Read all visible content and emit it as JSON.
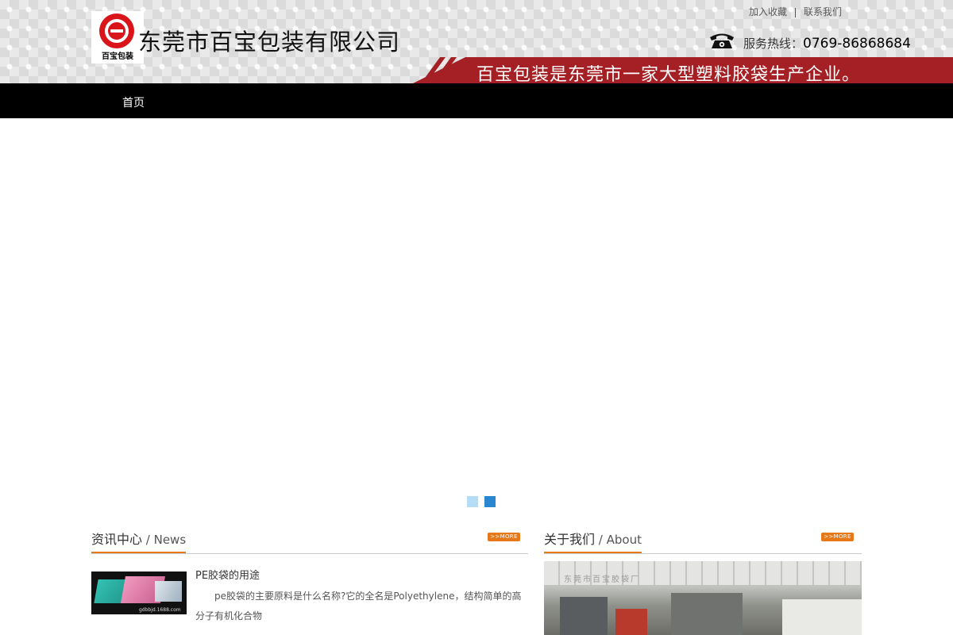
{
  "header": {
    "logo_text": "百宝包装",
    "company_name": "东莞市百宝包装有限公司",
    "top_links": [
      "加入收藏",
      "联系我们"
    ],
    "hotline_label": "服务热线：",
    "hotline_number": "0769-86868684",
    "slogan": "百宝包装是东莞市一家大型塑料胶袋生产企业。"
  },
  "nav": {
    "items": [
      "首页"
    ]
  },
  "banner": {
    "slide_count": 2,
    "active_slide": 2
  },
  "news": {
    "title_cn": "资讯中心",
    "title_sep": " / ",
    "title_en": "News",
    "more_label": ">>MORE",
    "thumb_caption": "gdbbjd.1688.com",
    "item_title": "PE胶袋的用途",
    "item_desc": "pe胶袋的主要原料是什么名称?它的全名是Polyethylene，结构简单的高分子有机化合物"
  },
  "about": {
    "title_cn": "关于我们",
    "title_sep": " / ",
    "title_en": "About",
    "more_label": ">>MORE",
    "image_caption": "东莞市百宝胶袋厂"
  },
  "colors": {
    "accent_orange": "#e67817",
    "slogan_red": "#a52024",
    "nav_black": "#000000",
    "dot_active": "#2a86d0",
    "dot_inactive": "#b5dcf7"
  }
}
